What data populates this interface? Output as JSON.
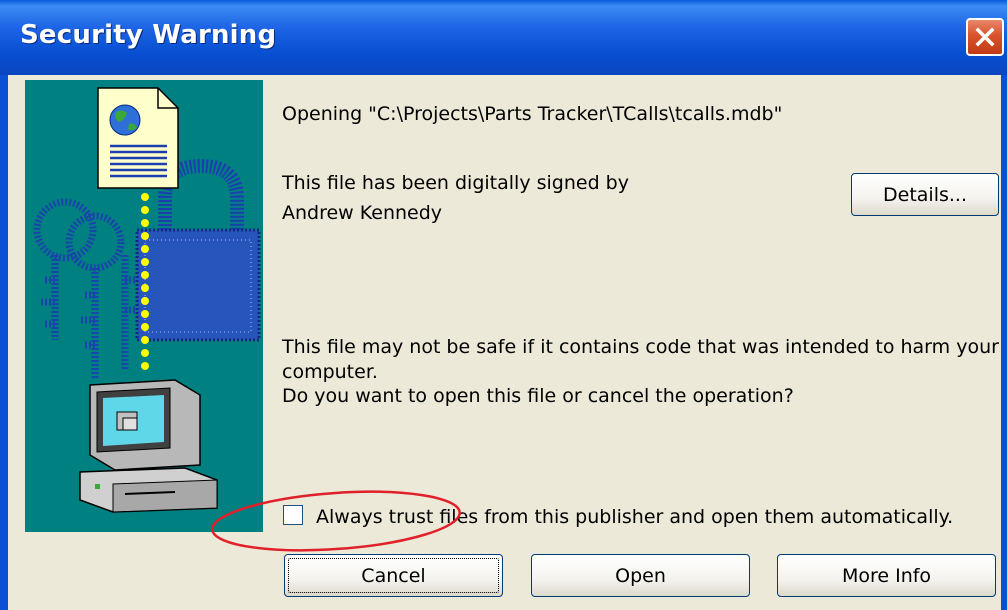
{
  "window": {
    "title": "Security Warning",
    "close_icon": "close-icon"
  },
  "message": {
    "opening": "Opening \"C:\\Projects\\Parts Tracker\\TCalls\\tcalls.mdb\"",
    "signed_line1": "This file has been digitally signed by",
    "signed_line2": "Andrew Kennedy",
    "warning_line1": "This file may not be safe if it contains code that was intended to harm your",
    "warning_line2": "computer.",
    "warning_line3": "Do you want to open this file or cancel the operation?"
  },
  "details_button": {
    "pre": "De",
    "accel": "t",
    "post": "ails..."
  },
  "trust": {
    "checked": false,
    "label": "Always trust files from this publisher and open them automatically."
  },
  "buttons": {
    "cancel": {
      "accel": "C",
      "post": "ancel"
    },
    "open": {
      "accel": "O",
      "post": "pen"
    },
    "more_info": {
      "accel": "M",
      "post": "ore Info"
    }
  },
  "illustration": {
    "icons": [
      "document-icon",
      "globe-icon",
      "padlock-icon",
      "keys-icon",
      "computer-icon"
    ],
    "background": "#008080"
  },
  "colors": {
    "titlebar": "#0a5adf",
    "close_button": "#d9532c",
    "annotation": "#e0202a"
  }
}
